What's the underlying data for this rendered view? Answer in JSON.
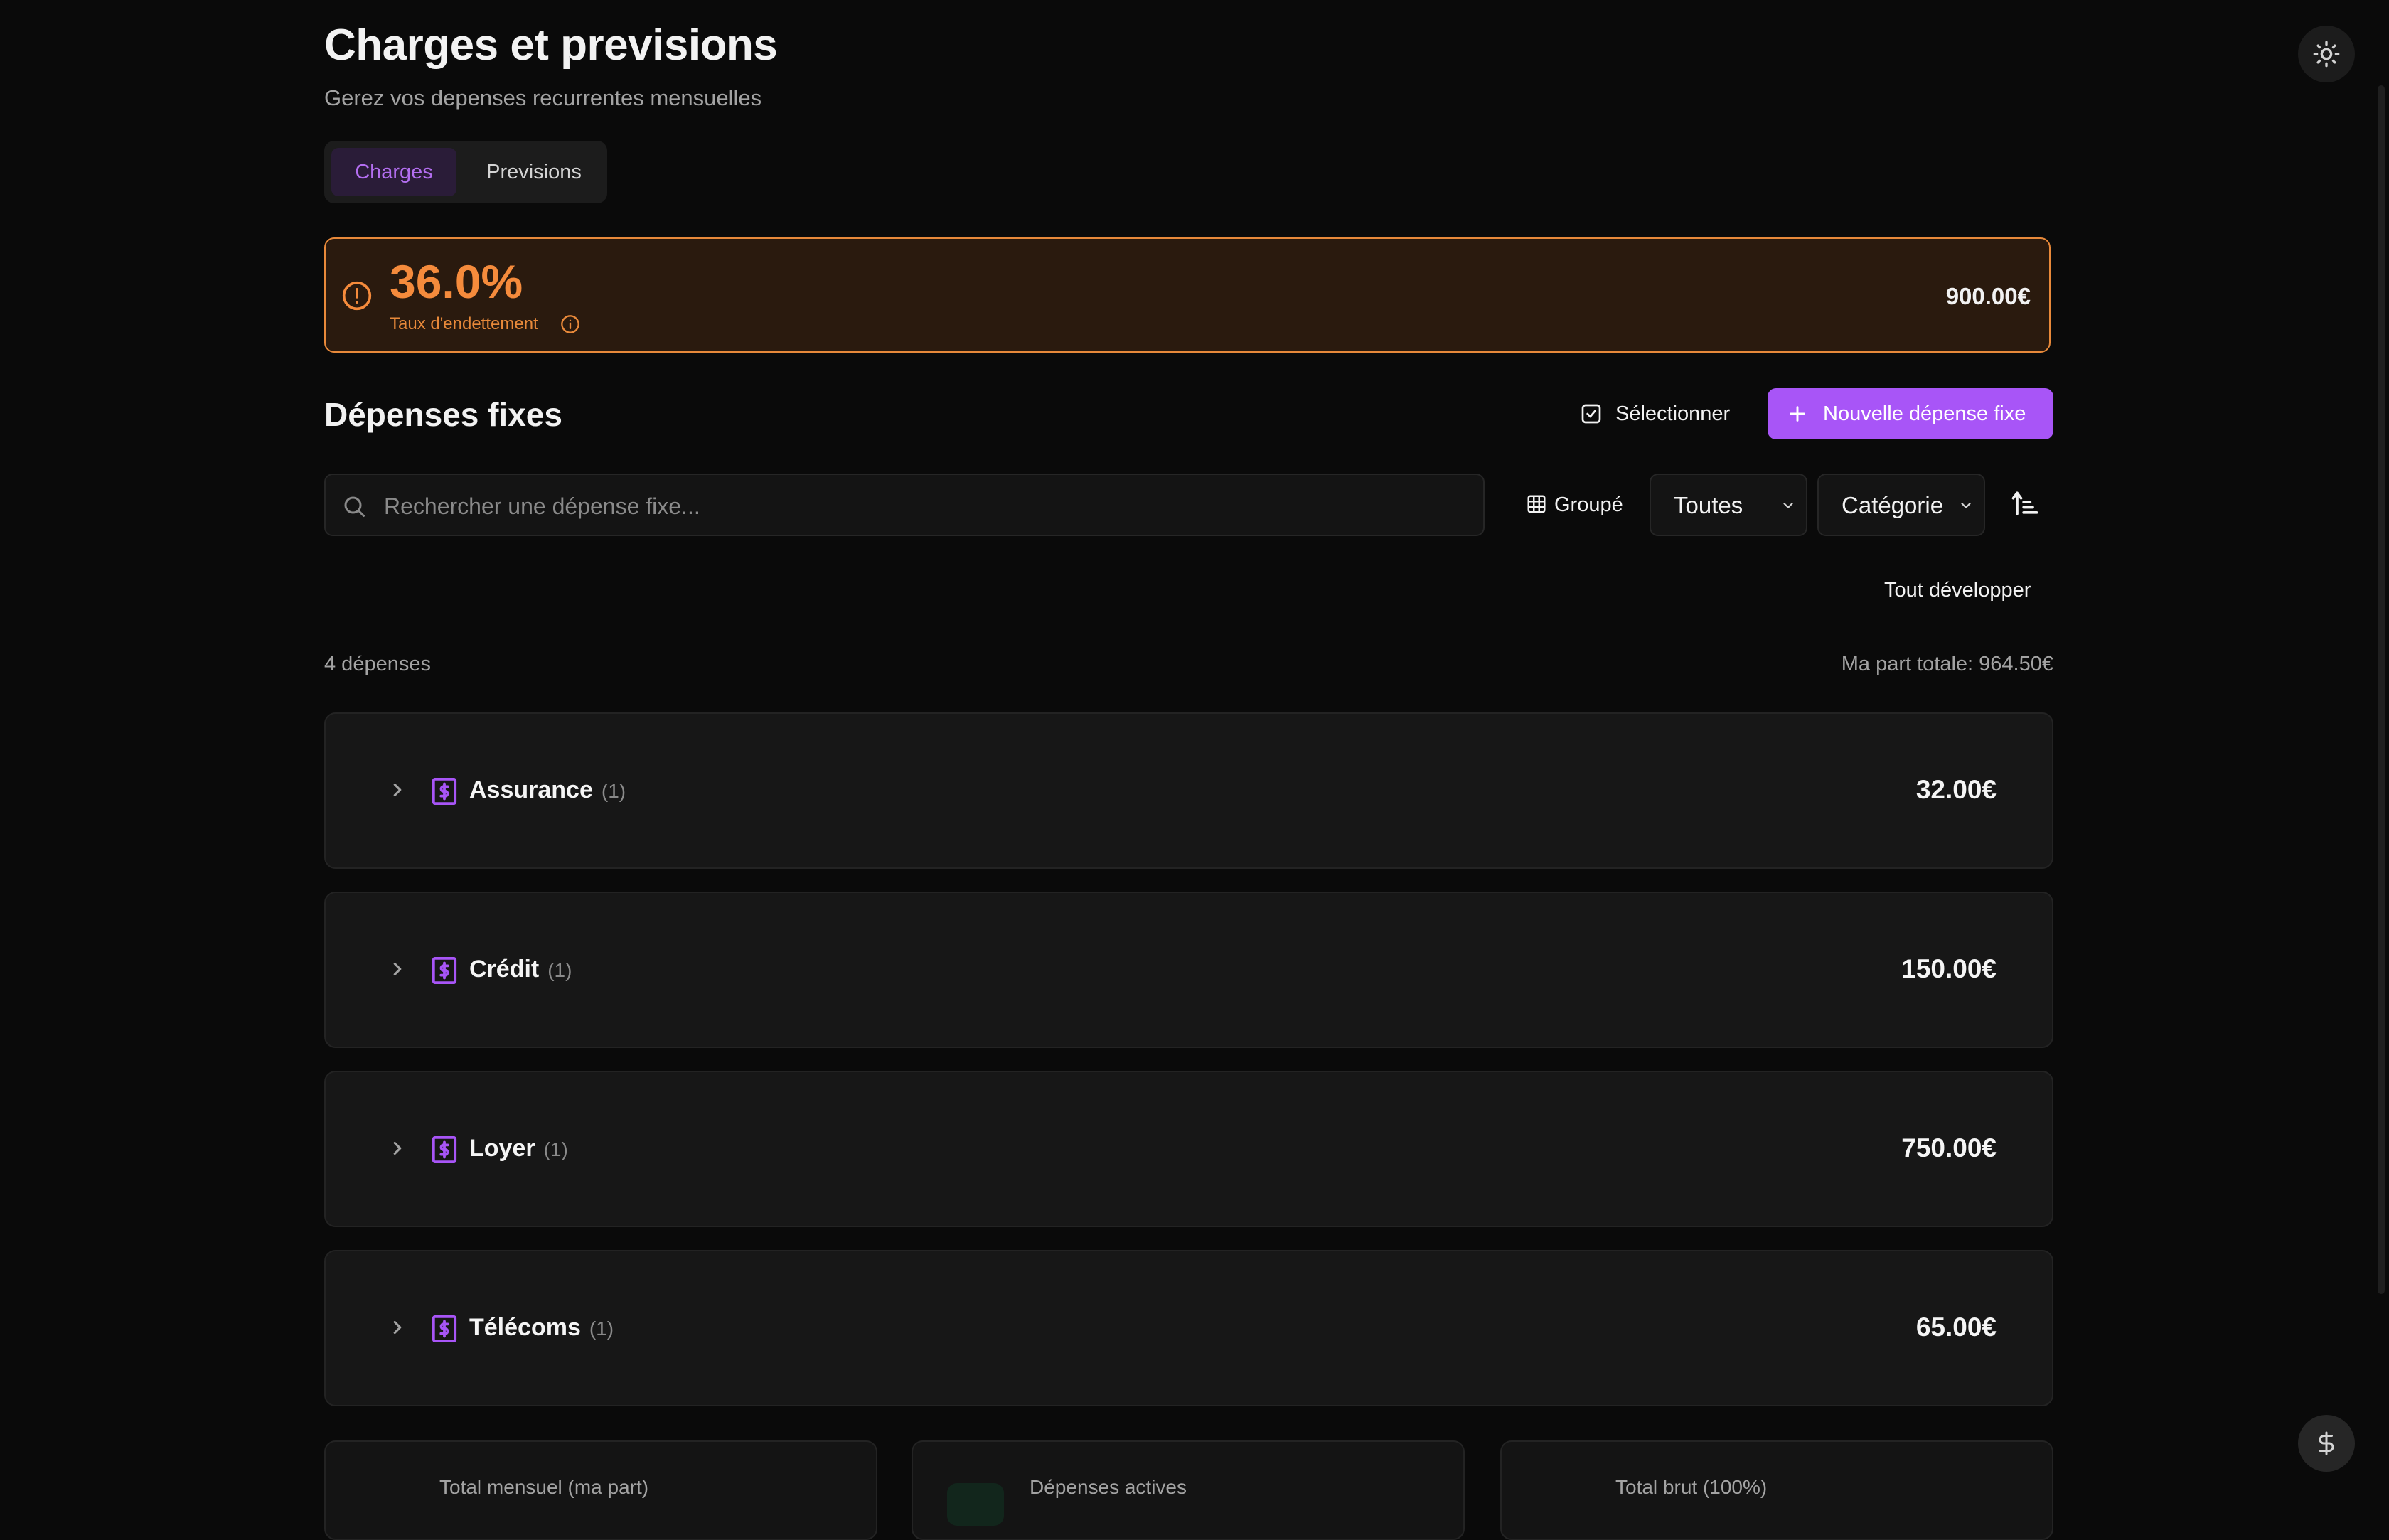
{
  "page": {
    "title": "Charges et previsions",
    "subtitle": "Gerez vos depenses recurrentes mensuelles"
  },
  "tabs": [
    {
      "label": "Charges",
      "active": true
    },
    {
      "label": "Previsions",
      "active": false
    }
  ],
  "alert": {
    "percentage": "36.0%",
    "label": "Taux d'endettement",
    "amount": "900.00€"
  },
  "section": {
    "title": "Dépenses fixes",
    "select_label": "Sélectionner",
    "new_label": "Nouvelle dépense fixe"
  },
  "filters": {
    "search_placeholder": "Rechercher une dépense fixe...",
    "group_label": "Groupé",
    "status_value": "Toutes",
    "sort_value": "Catégorie",
    "expand_all": "Tout développer"
  },
  "summary": {
    "count": "4 dépenses",
    "total_part": "Ma part totale: 964.50€"
  },
  "categories": [
    {
      "name": "Assurance",
      "count": "(1)",
      "amount": "32.00€"
    },
    {
      "name": "Crédit",
      "count": "(1)",
      "amount": "150.00€"
    },
    {
      "name": "Loyer",
      "count": "(1)",
      "amount": "750.00€"
    },
    {
      "name": "Télécoms",
      "count": "(1)",
      "amount": "65.00€"
    }
  ],
  "stats": [
    {
      "label": "Total mensuel (ma part)"
    },
    {
      "label": "Dépenses actives"
    },
    {
      "label": "Total brut (100%)"
    }
  ],
  "colors": {
    "accent": "#a855f7",
    "warning": "#f58b3c",
    "background": "#0a0a0a"
  },
  "icons": {
    "theme": "sun-icon",
    "fab": "dollar-icon",
    "alert": "alert-circle-icon"
  }
}
